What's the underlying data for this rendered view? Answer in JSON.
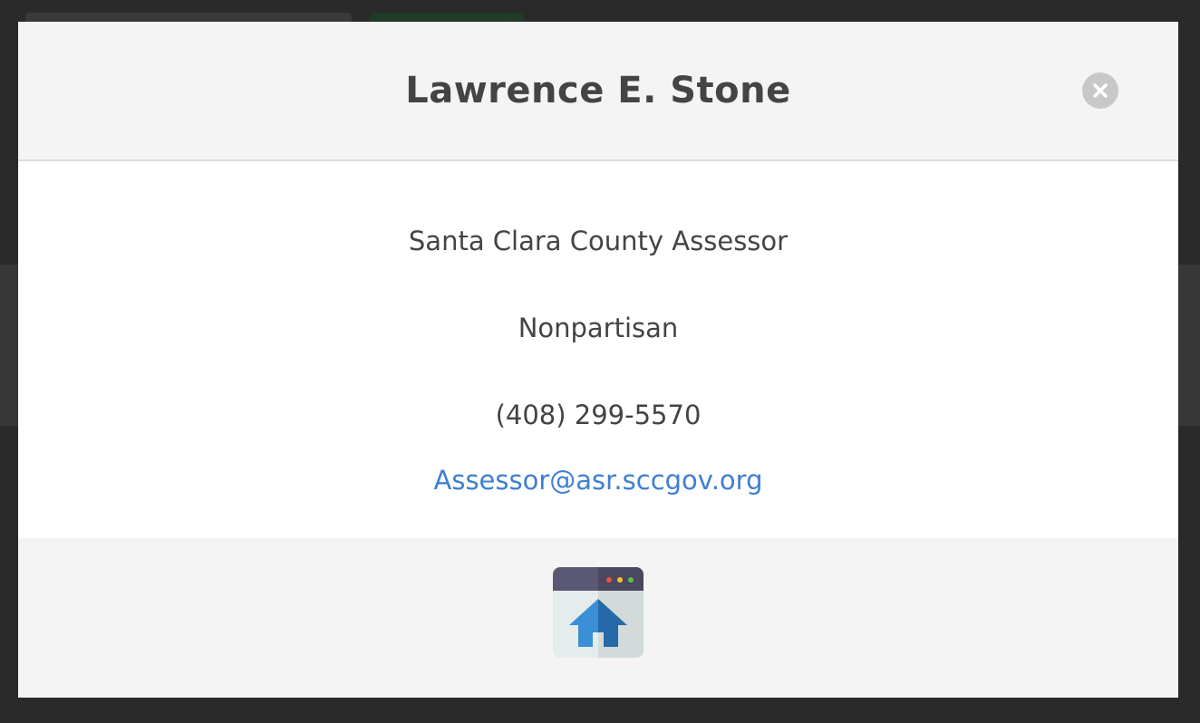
{
  "modal": {
    "title": "Lawrence E. Stone",
    "close_icon": "close-icon",
    "office": "Santa Clara County Assessor",
    "party": "Nonpartisan",
    "phone": "(408) 299-5570",
    "email": "Assessor@asr.sccgov.org",
    "website_icon": "website-home-icon"
  },
  "colors": {
    "header_bg": "#f4f4f4",
    "text": "#444444",
    "link": "#3f7fd0",
    "close_bg": "#c8c8c8",
    "backdrop": "#2a2a2a"
  }
}
